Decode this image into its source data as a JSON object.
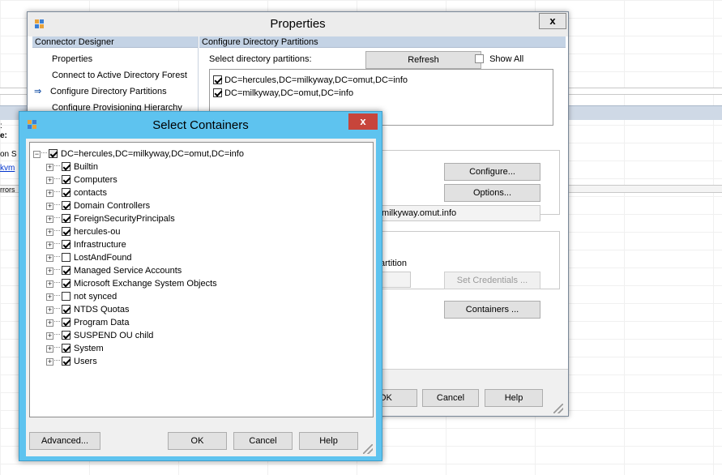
{
  "background": {
    "left_fragments": [
      {
        "text": ":",
        "link": false
      },
      {
        "text": "e:",
        "link": false
      },
      {
        "text": "on S",
        "link": false
      },
      {
        "text": "kvm",
        "link": true
      },
      {
        "text": "rrors",
        "link": false
      }
    ]
  },
  "properties": {
    "title": "Properties",
    "close_label": "x",
    "left_header": "Connector Designer",
    "nav": [
      {
        "label": "Properties",
        "active": false
      },
      {
        "label": "Connect to Active Directory Forest",
        "active": false
      },
      {
        "label": "Configure Directory Partitions",
        "active": true
      },
      {
        "label": "Configure Provisioning Hierarchy",
        "active": false
      }
    ],
    "nav_arrow": "⇒",
    "right_header": "Configure Directory Partitions",
    "select_label": "Select directory partitions:",
    "refresh_label": "Refresh",
    "show_all_label": "Show All",
    "show_all_checked": false,
    "partitions": [
      {
        "label": "DC=hercules,DC=milkyway,DC=omut,DC=info",
        "checked": true
      },
      {
        "label": "DC=milkyway,DC=omut,DC=info",
        "checked": true
      }
    ],
    "configure_label": "Configure...",
    "options_label": "Options...",
    "domain_value": ".milkyway.omut.info",
    "partition_fragment": "artition",
    "set_credentials_label": "Set Credentials ...",
    "containers_label": "Containers ...",
    "ok_fragment": "OK",
    "cancel_label": "Cancel",
    "help_label": "Help"
  },
  "select_containers": {
    "title": "Select Containers",
    "close_label": "x",
    "root": {
      "label": "DC=hercules,DC=milkyway,DC=omut,DC=info",
      "checked": true
    },
    "items": [
      {
        "label": "Builtin",
        "checked": true
      },
      {
        "label": "Computers",
        "checked": true
      },
      {
        "label": "contacts",
        "checked": true
      },
      {
        "label": "Domain Controllers",
        "checked": true
      },
      {
        "label": "ForeignSecurityPrincipals",
        "checked": true
      },
      {
        "label": "hercules-ou",
        "checked": true
      },
      {
        "label": "Infrastructure",
        "checked": true
      },
      {
        "label": "LostAndFound",
        "checked": false
      },
      {
        "label": "Managed Service Accounts",
        "checked": true
      },
      {
        "label": "Microsoft Exchange System Objects",
        "checked": true
      },
      {
        "label": "not synced",
        "checked": false
      },
      {
        "label": "NTDS Quotas",
        "checked": true
      },
      {
        "label": "Program Data",
        "checked": true
      },
      {
        "label": "SUSPEND OU child",
        "checked": true
      },
      {
        "label": "System",
        "checked": true
      },
      {
        "label": "Users",
        "checked": true
      }
    ],
    "advanced_label": "Advanced...",
    "ok_label": "OK",
    "cancel_label": "Cancel",
    "help_label": "Help"
  }
}
